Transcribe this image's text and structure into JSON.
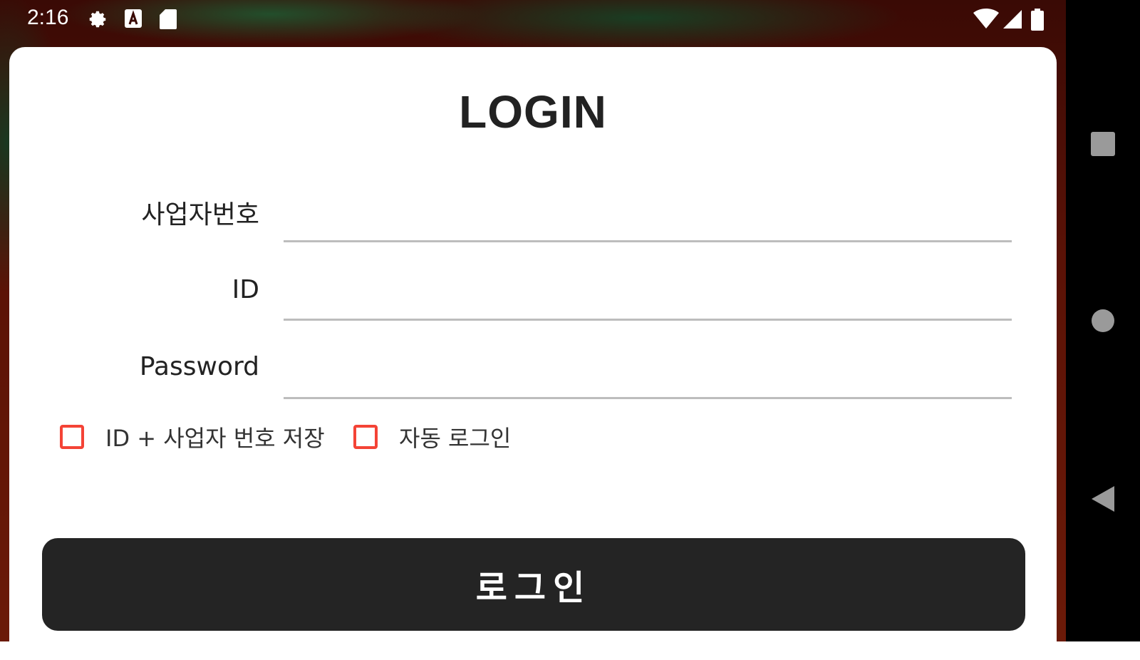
{
  "status_bar": {
    "time": "2:16",
    "icons": [
      "gear-icon",
      "font-a-icon",
      "sd-card-icon",
      "wifi-icon",
      "cellular-signal-icon",
      "battery-icon"
    ]
  },
  "login": {
    "title": "LOGIN",
    "fields": [
      {
        "label": "사업자번호",
        "value": ""
      },
      {
        "label": "ID",
        "value": ""
      },
      {
        "label": "Password",
        "value": ""
      }
    ],
    "checkboxes": [
      {
        "label": "ID + 사업자 번호 저장",
        "checked": false
      },
      {
        "label": "자동 로그인",
        "checked": false
      }
    ],
    "submit_label": "로그인"
  },
  "nav_bar": {
    "buttons": [
      "recents-icon",
      "home-icon",
      "back-icon"
    ]
  },
  "colors": {
    "accent_checkbox": "#f44336",
    "button_bg": "#242424",
    "card_bg": "#ffffff"
  }
}
